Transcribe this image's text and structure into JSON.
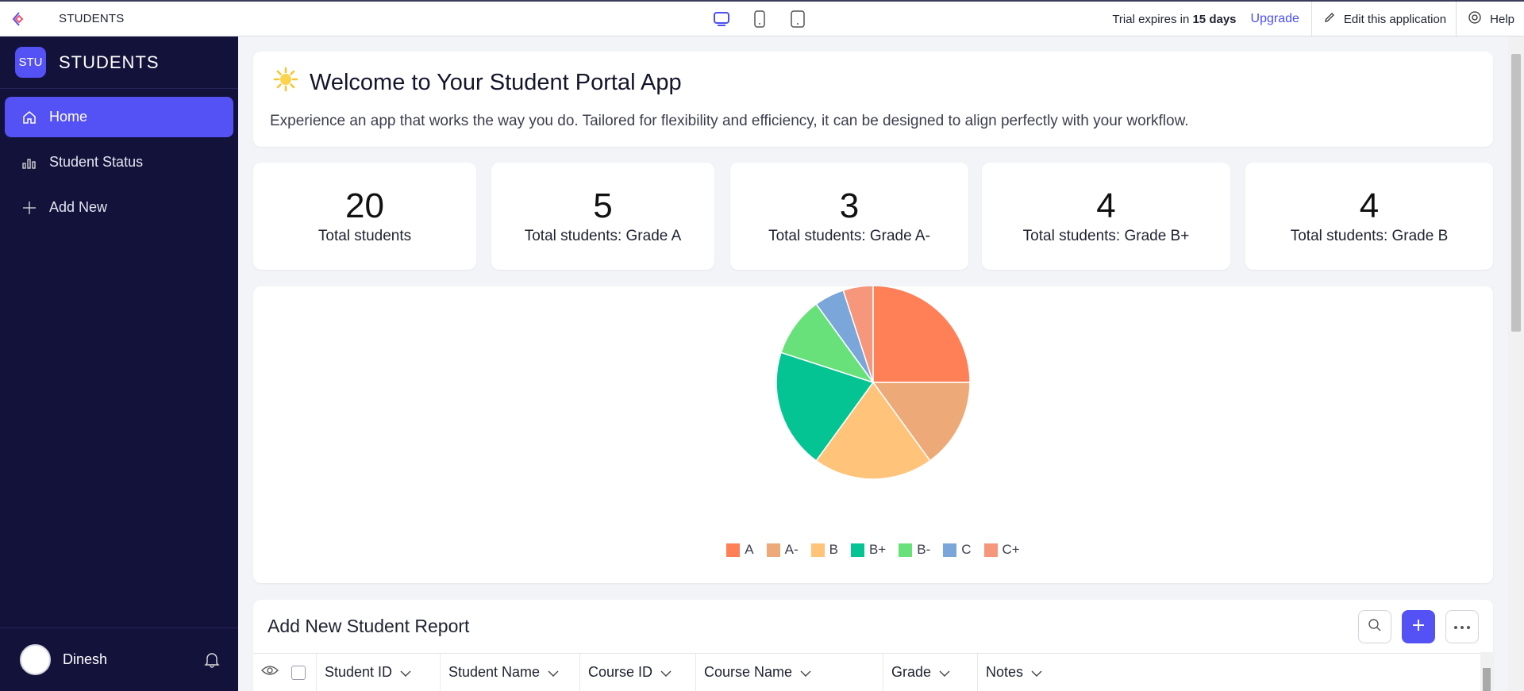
{
  "topbar": {
    "app_name": "STUDENTS",
    "trial_prefix": "Trial expires in",
    "trial_days": "15 days",
    "upgrade": "Upgrade",
    "edit_app": "Edit this application",
    "help": "Help"
  },
  "sidebar": {
    "avatar_text": "STU",
    "title": "STUDENTS",
    "items": [
      {
        "label": "Home",
        "icon": "home-icon",
        "active": true
      },
      {
        "label": "Student Status",
        "icon": "bar-chart-icon",
        "active": false
      },
      {
        "label": "Add New",
        "icon": "plus-icon",
        "active": false
      }
    ],
    "user": {
      "name": "Dinesh"
    }
  },
  "welcome": {
    "title": "Welcome to Your Student Portal App",
    "text": "Experience an app that works the way you do. Tailored for flexibility and efficiency, it can be designed to align perfectly with your workflow."
  },
  "stats": [
    {
      "value": "20",
      "label": "Total students"
    },
    {
      "value": "5",
      "label": "Total students: Grade A"
    },
    {
      "value": "3",
      "label": "Total students: Grade A-"
    },
    {
      "value": "4",
      "label": "Total students: Grade B+"
    },
    {
      "value": "4",
      "label": "Total students: Grade B"
    }
  ],
  "chart_data": {
    "type": "pie",
    "categories": [
      "A",
      "A-",
      "B",
      "B+",
      "B-",
      "C",
      "C+"
    ],
    "values": [
      5,
      3,
      4,
      4,
      2,
      1,
      1
    ],
    "colors": [
      "#ff7f57",
      "#edaa78",
      "#ffc37a",
      "#05c493",
      "#69e17a",
      "#7aa6da",
      "#f6967a"
    ],
    "legend": "bottom"
  },
  "table": {
    "title": "Add New Student Report",
    "columns": [
      "Student ID",
      "Student Name",
      "Course ID",
      "Course Name",
      "Grade",
      "Notes"
    ]
  },
  "colors": {
    "accent": "#5451f5",
    "sidebar_bg": "#13123a"
  }
}
